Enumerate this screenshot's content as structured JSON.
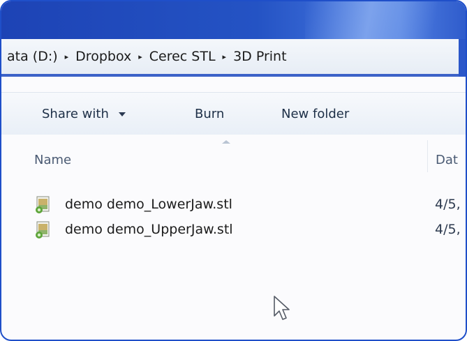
{
  "breadcrumb": {
    "items": [
      "ata (D:)",
      "Dropbox",
      "Cerec STL",
      "3D Print"
    ],
    "separator": "▸"
  },
  "toolbar": {
    "share_with_label": "Share with",
    "burn_label": "Burn",
    "new_folder_label": "New folder"
  },
  "columns": {
    "name_label": "Name",
    "date_label": "Dat"
  },
  "files": [
    {
      "name": "demo demo_LowerJaw.stl",
      "date": "4/5,",
      "icon": "stl-file-icon"
    },
    {
      "name": "demo demo_UpperJaw.stl",
      "date": "4/5,",
      "icon": "stl-file-icon"
    }
  ],
  "colors": {
    "window_frame": "#1f4fc9",
    "title_bar": "#2453c4",
    "toolbar_text": "#1d2f47",
    "header_text": "#4a5a73"
  }
}
